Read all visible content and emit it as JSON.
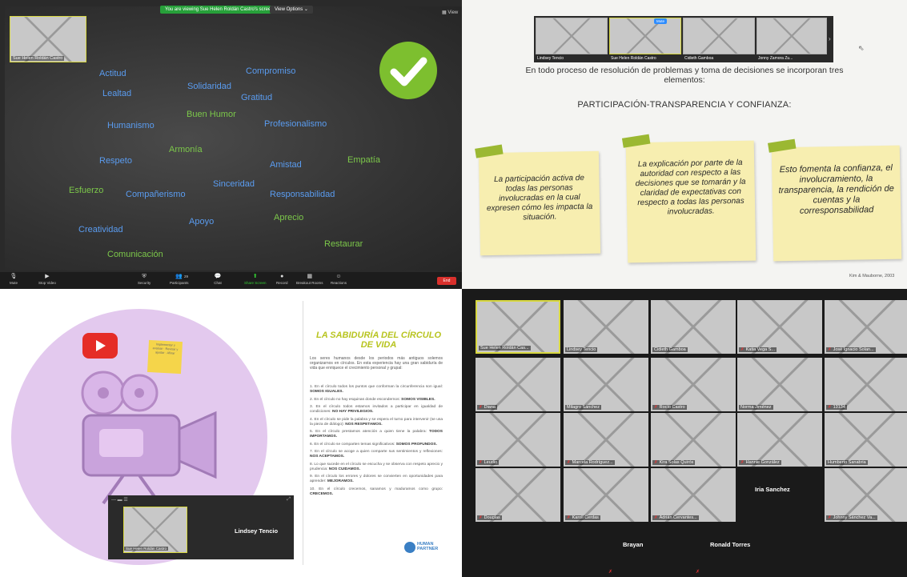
{
  "q1": {
    "share_banner": "You are viewing Sue Helen Roldán Castro's screen",
    "view_options": "View Options ⌄",
    "view_mini": "▦ View",
    "self_name": "Sue Helen Roldán Castro",
    "words": [
      {
        "text": "Actitud",
        "color": "blue"
      },
      {
        "text": "Compromiso",
        "color": "blue"
      },
      {
        "text": "Lealtad",
        "color": "blue"
      },
      {
        "text": "Solidaridad",
        "color": "blue"
      },
      {
        "text": "Gratitud",
        "color": "blue"
      },
      {
        "text": "Buen Humor",
        "color": "green"
      },
      {
        "text": "Humanismo",
        "color": "blue"
      },
      {
        "text": "Profesionalismo",
        "color": "blue"
      },
      {
        "text": "Armonía",
        "color": "green"
      },
      {
        "text": "Respeto",
        "color": "blue"
      },
      {
        "text": "Empatía",
        "color": "green"
      },
      {
        "text": "Amistad",
        "color": "blue"
      },
      {
        "text": "Esfuerzo",
        "color": "green"
      },
      {
        "text": "Compañerismo",
        "color": "blue"
      },
      {
        "text": "Sinceridad",
        "color": "blue"
      },
      {
        "text": "Responsabilidad",
        "color": "blue"
      },
      {
        "text": "Aprecio",
        "color": "green"
      },
      {
        "text": "Apoyo",
        "color": "blue"
      },
      {
        "text": "Creatividad",
        "color": "blue"
      },
      {
        "text": "Restaurar",
        "color": "green"
      },
      {
        "text": "Comunicación",
        "color": "green"
      }
    ],
    "toolbar": [
      {
        "label": "Mute",
        "icon": "mic-icon"
      },
      {
        "label": "Stop Video",
        "icon": "video-icon"
      },
      {
        "label": "Security",
        "icon": "shield-icon"
      },
      {
        "label": "Participants",
        "icon": "people-icon",
        "count": "29"
      },
      {
        "label": "Chat",
        "icon": "chat-icon"
      },
      {
        "label": "Share Screen",
        "icon": "share-screen-icon"
      },
      {
        "label": "Record",
        "icon": "record-icon"
      },
      {
        "label": "Breakout Rooms",
        "icon": "breakout-icon"
      },
      {
        "label": "Reactions",
        "icon": "reactions-icon"
      }
    ],
    "end_label": "End",
    "colors": {
      "blue": "#5a9cf0",
      "green": "#7cc84a",
      "check": "#7dbf2f"
    }
  },
  "q2": {
    "strip_names": [
      "Lindsey Tencio",
      "Sue Helen Roldán Castro",
      "Cidieth Gamboa",
      "Jonny Zamora Zu..."
    ],
    "mute_label": "Mute",
    "title": "En todo proceso de resolución de problemas y toma de decisiones se incorporan tres elementos:",
    "heading": "PARTICIPACIÓN-TRANSPARENCIA Y CONFIANZA:",
    "notes": [
      "La participación activa de todas las personas involucradas en la cual expresen cómo les impacta la situación.",
      "La explicación por parte de la autoridad con respecto a las decisiones que se tomarán y la claridad de expectativas con respecto a todas las personas involucradas.",
      "Esto fomenta la confianza, el involucramiento, la transparencia, la rendición de cuentas y la corresponsabilidad"
    ],
    "citation": "Kim & Mauborne, 2003"
  },
  "q3": {
    "sticky_text": "Implementar y evaluar · Revisar y ajustar · Afinar",
    "zoom_name": "Lindsey Tencio",
    "zoom_self": "Sue Helen Roldán Castro",
    "title": "LA SABIDURÍA DEL CÍRCULO DE VIDA",
    "intro": "Los seres humanos desde los periodos más antiguos solemos organizarnos en círculos. En esta experiencia hay una gran sabiduría de vida que enriquece el crecimiento personal y grupal:",
    "items": [
      {
        "text": "1. En el círculo todos los puntos que conforman la circunferencia son igual:",
        "bold": "SOMOS IGUALES."
      },
      {
        "text": "2. En el círculo no hay esquinas donde escondernos:",
        "bold": "SOMOS VISIBLES."
      },
      {
        "text": "3. En el círculo todos estamos invitados a participar en igualdad de condiciones:",
        "bold": "NO HAY PRIVILEGIOS."
      },
      {
        "text": "4. En el círculo se pide la palabra y se espera el turno para intervenir (se usa la pieza de diálogo):",
        "bold": "NOS RESPETAMOS."
      },
      {
        "text": "5. En el círculo prestamos atención a quien tiene la palabra:",
        "bold": "TODOS IMPORTAMOS."
      },
      {
        "text": "6. En el círculo se comparten temas significativos:",
        "bold": "SOMOS PROFUNDOS."
      },
      {
        "text": "7. En el círculo se acoge a quien comparte sus sentimientos y reflexiones:",
        "bold": "NOS ACEPTAMOS."
      },
      {
        "text": "8. Lo que sucede en el círculo se escucha y se observa con respeto aprecio y prudencia:",
        "bold": "NOS CUIDAMOS."
      },
      {
        "text": "9. En el círculo los errores y dolores se convierten en oportunidades para aprender:",
        "bold": "MEJORAMOS."
      },
      {
        "text": "10. En el círculo crecemos, sanamos y maduramos como grupo:",
        "bold": "CRECEMOS."
      }
    ],
    "logo_text": "HUMAN PARTNER"
  },
  "q4": {
    "tiles": [
      {
        "name": "Sue Helen Roldán Cas...",
        "muted": false,
        "highlight": true
      },
      {
        "name": "Lindsey Tencio",
        "muted": false
      },
      {
        "name": "Cidieth Gamboa",
        "muted": false
      },
      {
        "name": "Katia Vega S...",
        "muted": true
      },
      {
        "name": "José Ignacio Solan...",
        "muted": true
      },
      {
        "name": "Diana",
        "muted": true
      },
      {
        "name": "Milagro Sánchez",
        "muted": false
      },
      {
        "name": "Rocío Castro",
        "muted": true
      },
      {
        "name": "Norma Jiménez",
        "muted": false
      },
      {
        "name": "13134",
        "muted": true
      },
      {
        "name": "Leudio",
        "muted": true
      },
      {
        "name": "Marcela Rodríguez...",
        "muted": true
      },
      {
        "name": "Kira Solas Quirós",
        "muted": true
      },
      {
        "name": "Hannie González",
        "muted": true
      },
      {
        "name": "Humberto Sanabria",
        "muted": false
      },
      {
        "name": "Douglas",
        "muted": true
      },
      {
        "name": "Karoll Cerdas",
        "muted": true
      },
      {
        "name": "Adrián Cervantes...",
        "muted": true
      },
      {
        "name": "Iria Sanchez",
        "muted": false,
        "empty": true
      },
      {
        "name": "Johnny Sánchez Va...",
        "muted": true
      },
      {
        "name": "Brayan",
        "muted": true,
        "empty": true
      },
      {
        "name": "Ronald Torres",
        "muted": true,
        "empty": true
      }
    ]
  }
}
